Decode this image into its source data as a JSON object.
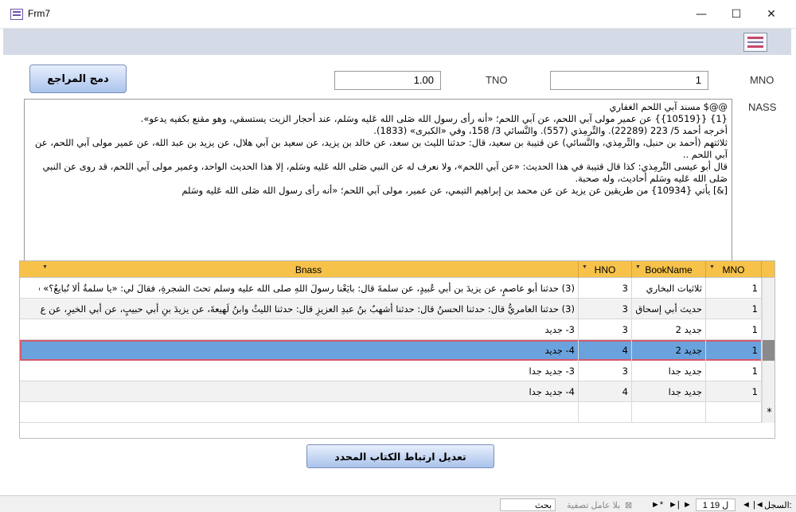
{
  "window": {
    "title": "Frm7",
    "minimize": "—",
    "maximize": "☐",
    "close": "✕"
  },
  "form": {
    "merge_button": "دمج المراجع",
    "tno_label": "TNO",
    "tno_value": "1.00",
    "mno_label": "MNO",
    "mno_value": "1",
    "nass_label": "NASS",
    "nass_lines": [
      "@@$ مسند آبي اللحم الغفاري",
      "{1} {{10519}} عن عمير مولى آبي اللحم، عن آبي اللحم؛ «أنه رأى رسول الله صَلى الله عَليه وسَلم، عند أحجار الزيت يستسقي، وهو مقنع بكفيه يدعو».",
      "أخرجه أحمد 5/ 223 (22289). والتِّرمِذي (557). والنَّسائي 3/ 158، وفي «الكبرى» (1833).",
      "ثلاثتهم (أحمد بن حنبل، والتِّرمِذي، والنَّسائي) عن قتيبة بن سعيد، قال: حدثنا الليث بن سعد، عن خالد بن يزيد، عن سعيد بن آبي هلال، عن يزيد بن عبد الله، عن عمير مولى آبي اللحم، عن آبي اللحم ..",
      "قال أبو عيسى التِّرمِذي: كذا قال قتيبة في هذا الحديث: «عن آبي اللحم»، ولا نعرف له عن النبي صَلى الله عَليه وسَلم، إلا هذا الحديث الواحد، وعمير مولى آبي اللحم، قد روى عن النبي صَلى الله عَليه وسَلم أحاديث، وله صحبة.",
      "[&] يأتي {10934} من طريقين عن يزيد عن عن محمد بن إبراهيم التيمي، عن عمير، مولى آبي اللحم؛ «أنه رأى رسول الله صَلى الله عَليه وسَلم"
    ],
    "edit_button": "تعديل ارتباط الكتاب المحدد"
  },
  "grid": {
    "columns": [
      "MNO",
      "BookName",
      "HNO",
      "Bnass"
    ],
    "rows": [
      {
        "mno": "1",
        "book": "ثلاثيات البخاري",
        "hno": "3",
        "bnass": "(3) حدثنا أبو عاصمٍ، عن يزيدَ بن أبي عُبيدٍ، عن سلمةَ قال: بايَعْنا رسولَ اللهِ صلى الله عليه وسلم تحتَ الشجرةِ، فقالَ لي: «يا سلمةُ ألا تُبايعُ؟» قل"
      },
      {
        "mno": "1",
        "book": "حديث أبي إسحاق",
        "hno": "3",
        "bnass": "(3) حدثنا العامريُّ قال: حدثنا الحسنُ قال: حدثنا أشهبُ بنُ عبدِ العزيزِ قال: حدثنا الليثُ وابنُ لَهيعةَ، عن يزيدَ بنِ أبي حبيبٍ، عن أبي الخيرِ، عن ع"
      },
      {
        "mno": "1",
        "book": "جديد 2",
        "hno": "3",
        "bnass": "3- جديد"
      },
      {
        "mno": "1",
        "book": "جديد 2",
        "hno": "4",
        "bnass": "4- جديد"
      },
      {
        "mno": "1",
        "book": "جديد جدا",
        "hno": "3",
        "bnass": "3- جديد جدا"
      },
      {
        "mno": "1",
        "book": "جديد جدا",
        "hno": "4",
        "bnass": "4- جديد جدا"
      }
    ],
    "new_row_marker": "*"
  },
  "statusbar": {
    "record_label": "السجل:",
    "nav_first": "|◄",
    "nav_prev": "◄",
    "record_position": "1 ل 19",
    "nav_next": "►",
    "nav_last": "►|",
    "nav_new": "►*",
    "filter_label": "بلا عامل تصفية",
    "search_label": "بحث"
  }
}
